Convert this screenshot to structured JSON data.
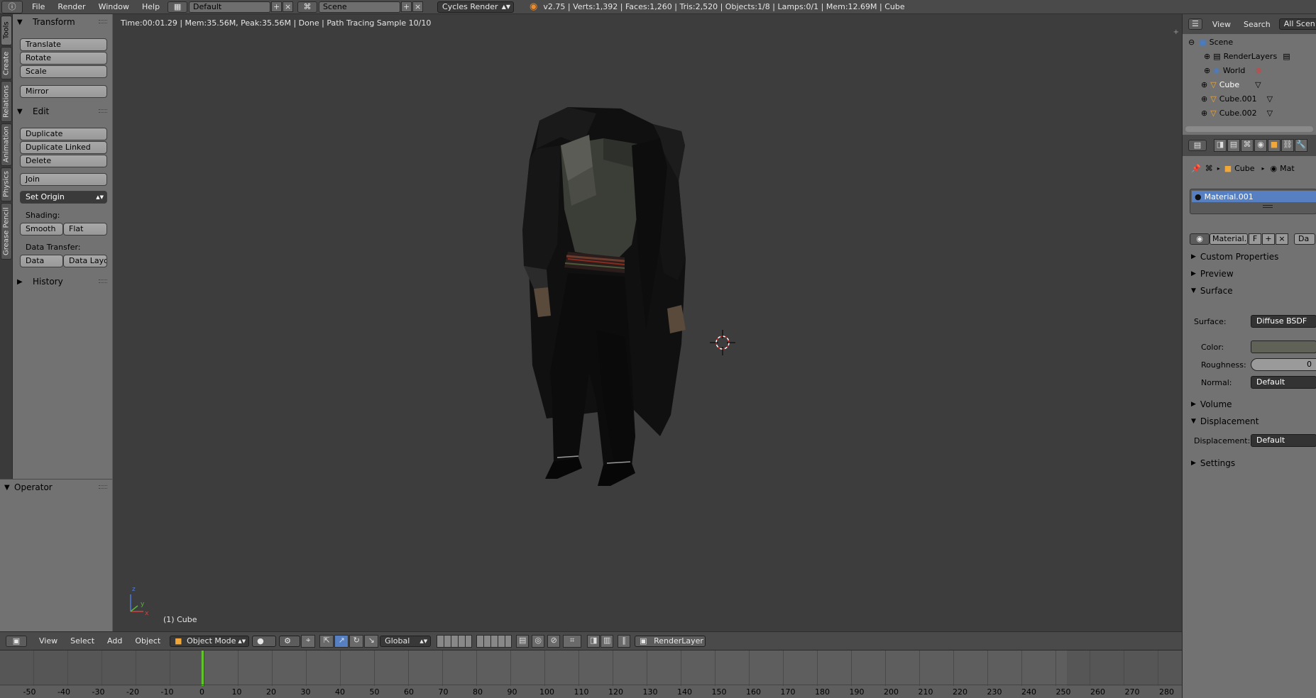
{
  "topbar": {
    "menus": [
      "File",
      "Render",
      "Window",
      "Help"
    ],
    "layout": "Default",
    "scene": "Scene",
    "render_engine": "Cycles Render",
    "stats": "v2.75 | Verts:1,392 | Faces:1,260 | Tris:2,520 | Objects:1/8 | Lamps:0/1 | Mem:12.69M | Cube"
  },
  "tool_tabs": [
    "Tools",
    "Create",
    "Relations",
    "Animation",
    "Physics",
    "Grease Pencil"
  ],
  "toolshelf": {
    "transform_title": "Transform",
    "translate": "Translate",
    "rotate": "Rotate",
    "scale": "Scale",
    "mirror": "Mirror",
    "edit_title": "Edit",
    "duplicate": "Duplicate",
    "duplicate_linked": "Duplicate Linked",
    "delete": "Delete",
    "join": "Join",
    "set_origin": "Set Origin",
    "shading_label": "Shading:",
    "smooth": "Smooth",
    "flat": "Flat",
    "data_transfer_label": "Data Transfer:",
    "data": "Data",
    "data_layout": "Data Layo",
    "history_title": "History"
  },
  "operator": {
    "title": "Operator"
  },
  "viewport": {
    "info": "Time:00:01.29 | Mem:35.56M, Peak:35.56M | Done | Path Tracing Sample 10/10",
    "object_label": "(1) Cube",
    "axis_x": "x",
    "axis_y": "y",
    "axis_z": "z"
  },
  "header3d": {
    "menus": [
      "View",
      "Select",
      "Add",
      "Object"
    ],
    "mode": "Object Mode",
    "orientation": "Global",
    "render_layer": "RenderLayer"
  },
  "timeline": {
    "ticks": [
      "-50",
      "-40",
      "-30",
      "-20",
      "-10",
      "0",
      "10",
      "20",
      "30",
      "40",
      "50",
      "60",
      "70",
      "80",
      "90",
      "100",
      "110",
      "120",
      "130",
      "140",
      "150",
      "160",
      "170",
      "180",
      "190",
      "200",
      "210",
      "220",
      "230",
      "240",
      "250",
      "260",
      "270",
      "280"
    ]
  },
  "outliner": {
    "view": "View",
    "search": "Search",
    "all_scenes": "All Scen",
    "rows": [
      "Scene",
      "RenderLayers",
      "World",
      "Cube",
      "Cube.001",
      "Cube.002"
    ]
  },
  "properties": {
    "breadcrumb_object": "Cube",
    "breadcrumb_material": "Mat",
    "material_slot": "Material.001",
    "material_name": "Material.",
    "fake_user": "F",
    "data_btn": "Da",
    "custom_properties": "Custom Properties",
    "preview": "Preview",
    "surface": "Surface",
    "surface_label": "Surface:",
    "surface_value": "Diffuse BSDF",
    "color_label": "Color:",
    "roughness_label": "Roughness:",
    "roughness_value": "0",
    "normal_label": "Normal:",
    "normal_value": "Default",
    "volume": "Volume",
    "displacement": "Displacement",
    "displacement_label": "Displacement:",
    "displacement_value": "Default",
    "settings": "Settings"
  },
  "colors": {
    "accent_selected": "#5680c2",
    "viewport_bg": "#3d3d3d",
    "timeline_frame": "#61c42b"
  }
}
